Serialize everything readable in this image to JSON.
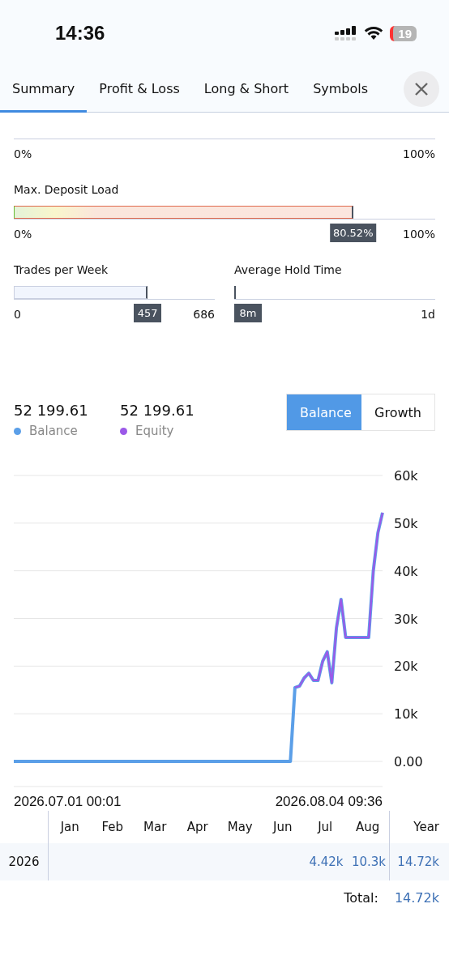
{
  "status_bar": {
    "time": "14:36",
    "battery": "19",
    "battery_low": true
  },
  "tabs": [
    {
      "label": "Summary",
      "selected": true
    },
    {
      "label": "Profit & Loss",
      "selected": false
    },
    {
      "label": "Long & Short",
      "selected": false
    },
    {
      "label": "Symbols",
      "selected": false
    }
  ],
  "gauges": [
    {
      "kind": "bare",
      "min": "0%",
      "max": "100%"
    },
    {
      "kind": "load",
      "title": "Max. Deposit Load",
      "level": 0.8052,
      "value": "80.52%",
      "min": "0%",
      "max": "100%"
    }
  ],
  "half_gauges": [
    {
      "title": "Trades per Week",
      "level": 0.666,
      "value": "457",
      "min": "0",
      "max": "686"
    },
    {
      "title": "Average Hold Time",
      "value": "8m",
      "max": "1d"
    }
  ],
  "summary": [
    {
      "value": "52 199.61",
      "label": "Balance",
      "color": "#5b9fe8"
    },
    {
      "value": "52 199.61",
      "label": "Equity",
      "color": "#9b59e8"
    }
  ],
  "toggle": [
    {
      "label": "Balance",
      "selected": true
    },
    {
      "label": "Growth",
      "selected": false
    }
  ],
  "chart_data": {
    "type": "line",
    "grid": true,
    "categories": [
      null,
      null,
      null,
      null,
      null,
      null,
      null,
      null,
      null,
      null,
      null,
      null,
      null,
      null,
      null,
      null,
      null,
      null,
      null,
      null,
      null,
      null,
      null,
      null,
      null,
      null,
      null,
      null,
      null,
      null,
      null,
      null,
      null,
      null,
      null,
      null,
      null,
      null,
      null,
      null,
      null,
      null,
      null,
      null,
      null,
      null,
      null,
      null,
      null,
      null,
      null,
      null,
      null,
      null,
      null,
      null,
      null,
      null,
      null,
      null,
      null,
      null,
      null,
      null,
      null,
      null,
      null,
      null,
      null,
      null,
      null,
      null,
      null,
      null,
      null,
      null,
      null,
      null,
      null,
      null,
      null
    ],
    "ylim": [
      0,
      60000
    ],
    "yticks": [
      {
        "value": 0,
        "label": "0.00"
      },
      {
        "value": 10000,
        "label": "10k"
      },
      {
        "value": 20000,
        "label": "20k"
      },
      {
        "value": 30000,
        "label": "30k"
      },
      {
        "value": 40000,
        "label": "40k"
      },
      {
        "value": 50000,
        "label": "50k"
      },
      {
        "value": 60000,
        "label": "60k"
      }
    ],
    "series": [
      {
        "color": "#5b9fe8",
        "values": [
          0,
          0,
          0,
          0,
          0,
          0,
          0,
          0,
          0,
          0,
          0,
          0,
          0,
          0,
          0,
          0,
          0,
          0,
          0,
          0,
          0,
          0,
          0,
          0,
          0,
          0,
          0,
          0,
          0,
          0,
          0,
          0,
          0,
          0,
          0,
          0,
          0,
          0,
          0,
          0,
          0,
          0,
          0,
          0,
          0,
          0,
          0,
          0,
          0,
          0,
          0,
          0,
          0,
          0,
          0,
          0,
          0,
          0,
          0,
          0,
          0,
          15500,
          15800,
          17500,
          18500,
          17000,
          17000,
          21000,
          23000,
          16500,
          28000,
          34000,
          26000,
          26000,
          26000,
          26000,
          26000,
          26000,
          40000,
          48000,
          52200
        ]
      },
      {
        "color": "#9b59e8",
        "values": [
          null,
          null,
          null,
          null,
          null,
          null,
          null,
          null,
          null,
          null,
          null,
          null,
          null,
          null,
          null,
          null,
          null,
          null,
          null,
          null,
          null,
          null,
          null,
          null,
          null,
          null,
          null,
          null,
          null,
          null,
          null,
          null,
          null,
          null,
          null,
          null,
          null,
          null,
          null,
          null,
          null,
          null,
          null,
          null,
          null,
          null,
          null,
          null,
          null,
          null,
          null,
          null,
          null,
          null,
          null,
          null,
          null,
          null,
          null,
          null,
          null,
          15500,
          15800,
          17500,
          18500,
          17000,
          17000,
          21000,
          23000,
          16500,
          28000,
          34000,
          26000,
          26000,
          26000,
          26000,
          26000,
          26000,
          40000,
          48000,
          52200
        ]
      }
    ]
  },
  "date_range": {
    "start": "2026.07.01 00:01",
    "end": "2026.08.04 09:36"
  },
  "table": {
    "columns": [
      "Jan",
      "Feb",
      "Mar",
      "Apr",
      "May",
      "Jun",
      "Jul",
      "Aug"
    ],
    "year_column": "Year",
    "rows": [
      {
        "label": "2026",
        "values": [
          "4.42k",
          "10.3k"
        ],
        "year_total": "14.72k"
      }
    ],
    "total_label": "Total:",
    "total": "14.72k"
  }
}
